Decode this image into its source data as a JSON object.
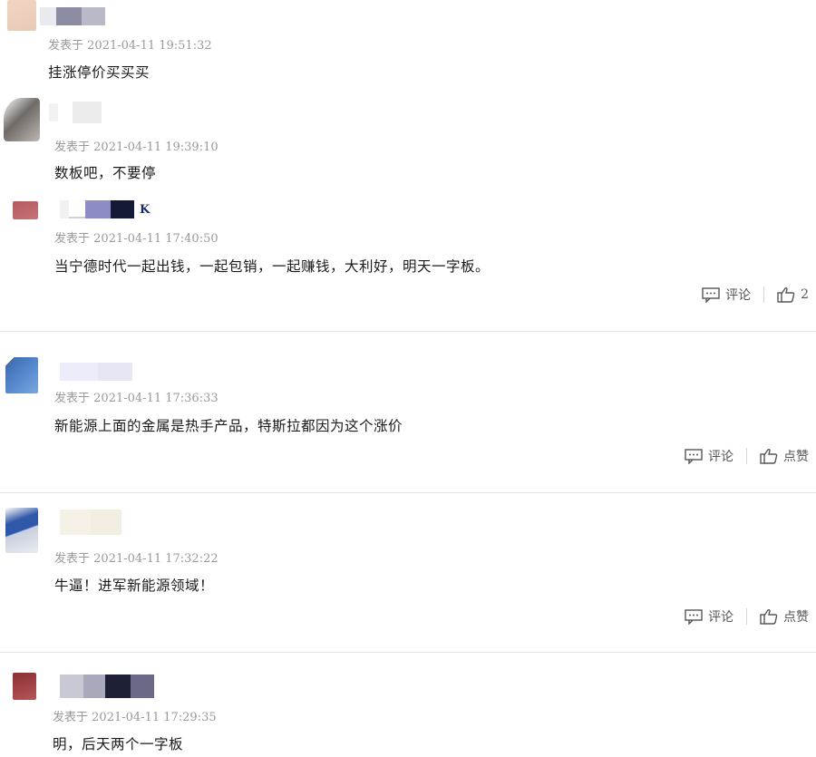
{
  "comments": [
    {
      "prefix": "发表于",
      "time": "2021-04-11 19:51:32",
      "text": "挂涨停价买买买",
      "avatar_colors": [
        "#f1d5c4",
        "#e8c9b6"
      ],
      "name_colors": [
        "#e9e9f0",
        "#8c8ca2",
        "#b9b9c8"
      ]
    },
    {
      "prefix": "发表于",
      "time": "2021-04-11 19:39:10",
      "text": "数板吧，不要停",
      "avatar_colors": [
        "#6f6a66",
        "#bdb8b2"
      ],
      "name_colors": [
        "#f2f2f2",
        "#ececec"
      ]
    },
    {
      "prefix": "发表于",
      "time": "2021-04-11 17:40:50",
      "text": "当宁德时代一起出钱，一起包销，一起赚钱，大利好，明天一字板。",
      "avatar_colors": [
        "#b45a5e",
        "#c47477"
      ],
      "name_colors": [
        "#f1f1f1",
        "#cfcfd8",
        "#8e8cc4",
        "#141a36"
      ],
      "name_suffix": "K",
      "comment_label": "评论",
      "like_label": "2"
    },
    {
      "prefix": "发表于",
      "time": "2021-04-11 17:36:33",
      "text": "新能源上面的金属是热手产品，特斯拉都因为这个涨价",
      "avatar_colors": [
        "#5b8ed0",
        "#3f6fb5"
      ],
      "name_colors": [
        "#ececfa",
        "#e6e6f4"
      ],
      "comment_label": "评论",
      "like_label": "点赞"
    },
    {
      "prefix": "发表于",
      "time": "2021-04-11 17:32:22",
      "text": "牛逼！进军新能源领域！",
      "avatar_colors": [
        "#2f58a8",
        "#c9cfdc"
      ],
      "name_colors": [
        "#f6f1e6",
        "#f3eee2"
      ],
      "comment_label": "评论",
      "like_label": "点赞"
    },
    {
      "prefix": "发表于",
      "time": "2021-04-11 17:29:35",
      "text": "明，后天两个一字板",
      "avatar_colors": [
        "#8a2f32",
        "#b55559"
      ],
      "name_colors": [
        "#c9c9d6",
        "#a9a9bc",
        "#1e2036",
        "#6a6a88"
      ]
    }
  ]
}
